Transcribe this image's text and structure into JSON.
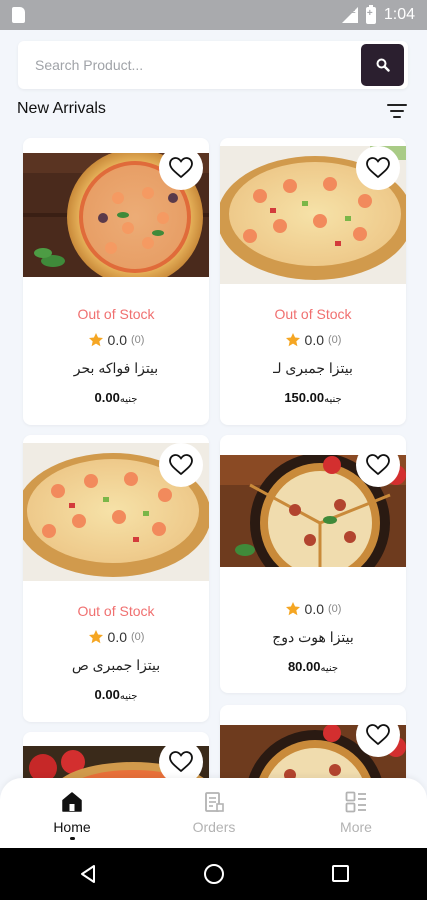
{
  "status_bar": {
    "time": "1:04",
    "network": "LTE"
  },
  "search": {
    "placeholder": "Search Product..."
  },
  "section": {
    "title": "New Arrivals"
  },
  "products": [
    {
      "stock": "Out of Stock",
      "rating": "0.0",
      "count": "(0)",
      "name": "بيتزا فواكه بحر",
      "price": "0.00",
      "currency": "جنيه"
    },
    {
      "stock": "Out of Stock",
      "rating": "0.0",
      "count": "(0)",
      "name": "بيتزا جمبرى  لـ",
      "price": "150.00",
      "currency": "جنيه"
    },
    {
      "stock": "Out of Stock",
      "rating": "0.0",
      "count": "(0)",
      "name": "بيتزا جمبرى  ص",
      "price": "0.00",
      "currency": "جنيه"
    },
    {
      "stock": "",
      "rating": "0.0",
      "count": "(0)",
      "name": "بيتزا هوت دوج",
      "price": "80.00",
      "currency": "جنيه"
    }
  ],
  "nav": {
    "home": "Home",
    "orders": "Orders",
    "more": "More"
  },
  "colors": {
    "accent": "#2b1f2f",
    "stock": "#f07070",
    "star": "#f5a623"
  }
}
